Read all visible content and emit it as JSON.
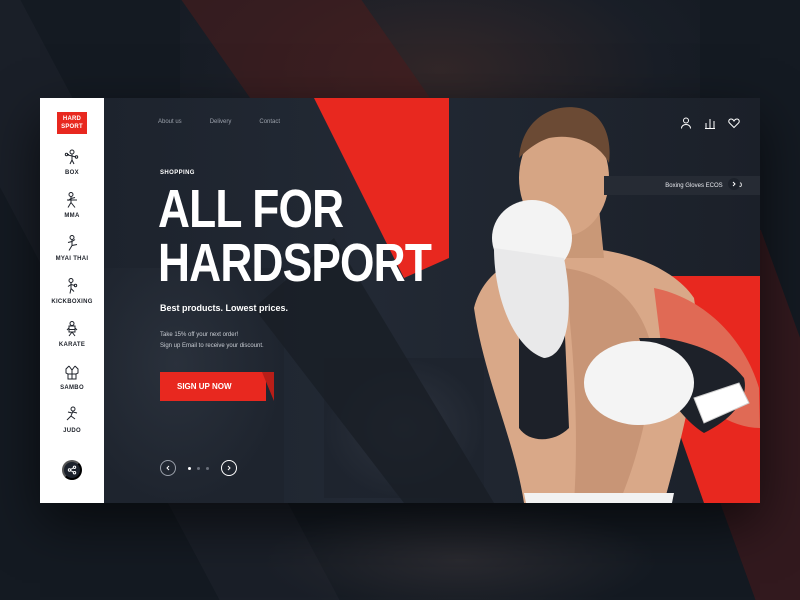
{
  "brand": {
    "logo_line1": "HARD",
    "logo_line2": "SPORT"
  },
  "sidebar": {
    "items": [
      {
        "label": "BOX",
        "icon": "boxer-icon"
      },
      {
        "label": "MMA",
        "icon": "mma-fighter-icon"
      },
      {
        "label": "MYAI THAI",
        "icon": "muay-thai-icon"
      },
      {
        "label": "KICKBOXING",
        "icon": "kickboxer-icon"
      },
      {
        "label": "KARATE",
        "icon": "karate-icon"
      },
      {
        "label": "SAMBO",
        "icon": "sambo-jacket-icon"
      },
      {
        "label": "JUDO",
        "icon": "judo-icon"
      }
    ],
    "share_icon": "share-icon"
  },
  "header": {
    "nav": [
      "About us",
      "Delivery",
      "Contact"
    ],
    "icons": [
      "user-icon",
      "stats-icon",
      "heart-icon"
    ]
  },
  "product": {
    "name": "Boxing Gloves ECOS",
    "price": "$150"
  },
  "hero": {
    "eyebrow": "SHOPPING",
    "title_line1": "ALL FOR",
    "title_line2": "HARDSPORT",
    "subtitle": "Best products. Lowest prices.",
    "promo_line1": "Take 15% off your next order!",
    "promo_line2": "Sign up Email to receive your discount.",
    "cta": "SIGN UP NOW"
  },
  "slider": {
    "total": 3,
    "active": 1
  },
  "colors": {
    "accent": "#e8281f",
    "dark": "#1c222c",
    "light": "#ffffff"
  }
}
